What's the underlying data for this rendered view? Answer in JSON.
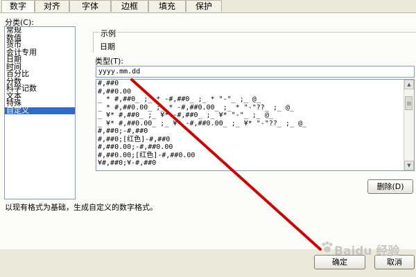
{
  "tabs": [
    {
      "label": "数字",
      "active": true
    },
    {
      "label": "对齐",
      "active": false
    },
    {
      "label": "字体",
      "active": false
    },
    {
      "label": "边框",
      "active": false
    },
    {
      "label": "填充",
      "active": false
    },
    {
      "label": "保护",
      "active": false
    }
  ],
  "category": {
    "label": "分类(C):",
    "items": [
      "常规",
      "数值",
      "货币",
      "会计专用",
      "日期",
      "时间",
      "百分比",
      "分数",
      "科学记数",
      "文本",
      "特殊",
      "自定义"
    ],
    "selected": "自定义"
  },
  "sample": {
    "label": "示例",
    "value": "日期"
  },
  "type": {
    "label": "类型(T):",
    "value": "yyyy.mm.dd"
  },
  "formats": [
    "#,##0",
    "#,##0.00",
    "_ * #,##0_ ;_ * -#,##0_ ;_ * \"-\"_ ;_ @_",
    "_ * #,##0.00_ ;_ * -#,##0.00_ ;_ * \"-\"??_ ;_ @_",
    "_ ¥* #,##0_ ;_ ¥* -#,##0_ ;_ ¥* \"-\"_ ;_ @_",
    "_ ¥* #,##0.00_ ;_ ¥* -#,##0.00_ ;_ ¥* \"-\"??_ ;_ @_",
    "#,##0;-#,##0",
    "#,##0;[红色]-#,##0",
    "#,##0.00;-#,##0.00",
    "#,##0.00;[红色]-#,##0.00",
    "¥#,##0;¥-#,##0"
  ],
  "buttons": {
    "delete": "删除(D)",
    "ok": "确定",
    "cancel": "取消"
  },
  "description": "以现有格式为基础，生成自定义的数字格式。",
  "watermark": "Baidu 经验",
  "colors": {
    "selection": "#316ac5",
    "annotation": "#cc0000"
  }
}
